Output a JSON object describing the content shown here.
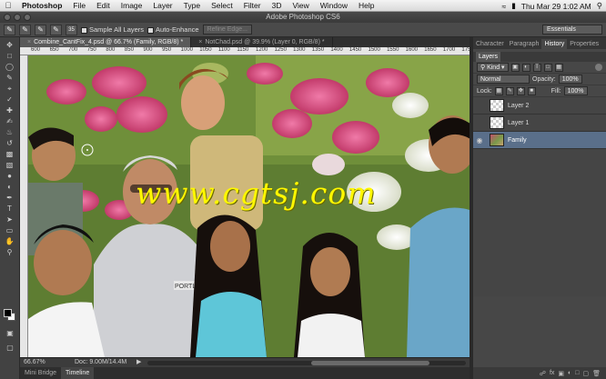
{
  "menubar": {
    "apple": "",
    "app_name": "Photoshop",
    "items": [
      "File",
      "Edit",
      "Image",
      "Layer",
      "Type",
      "Select",
      "Filter",
      "3D",
      "View",
      "Window",
      "Help"
    ],
    "clock": "Thu Mar 29  1:02 AM"
  },
  "window": {
    "title": "Adobe Photoshop CS6"
  },
  "options_bar": {
    "brush_size": "35",
    "sample_all_layers": "Sample All Layers",
    "auto_enhance": "Auto-Enhance",
    "refine_edge": "Refine Edge...",
    "workspace": "Essentials"
  },
  "doc_tabs": [
    {
      "label": "Combine_CantFix_4.psd @ 66.7% (Family, RGB/8) *",
      "active": true
    },
    {
      "label": "NotChad.psd @ 39.9% (Layer 0, RGB/8) *",
      "active": false
    }
  ],
  "ruler_ticks": [
    "600",
    "650",
    "700",
    "750",
    "800",
    "850",
    "900",
    "950",
    "1000",
    "1050",
    "1100",
    "1150",
    "1200",
    "1250",
    "1300",
    "1350",
    "1400",
    "1450",
    "1500",
    "1550",
    "1600",
    "1650",
    "1700",
    "1750"
  ],
  "watermark": "www.cgtsj.com",
  "canvas_sign_text": "PORTLA",
  "status": {
    "zoom": "66.67%",
    "doc": "Doc: 9.00M/14.4M"
  },
  "bottom_tabs": [
    "Mini Bridge",
    "Timeline"
  ],
  "panel_tabs": [
    "Character",
    "Paragraph",
    "History",
    "Properties"
  ],
  "layers_panel": {
    "title": "Layers",
    "kind_filter": "Kind",
    "blend_mode": "Normal",
    "opacity_label": "Opacity:",
    "opacity_value": "100%",
    "lock_label": "Lock:",
    "fill_label": "Fill:",
    "fill_value": "100%",
    "layers": [
      {
        "name": "Layer 2",
        "visible": false,
        "selected": false
      },
      {
        "name": "Layer 1",
        "visible": false,
        "selected": false
      },
      {
        "name": "Family",
        "visible": true,
        "selected": true
      }
    ]
  }
}
